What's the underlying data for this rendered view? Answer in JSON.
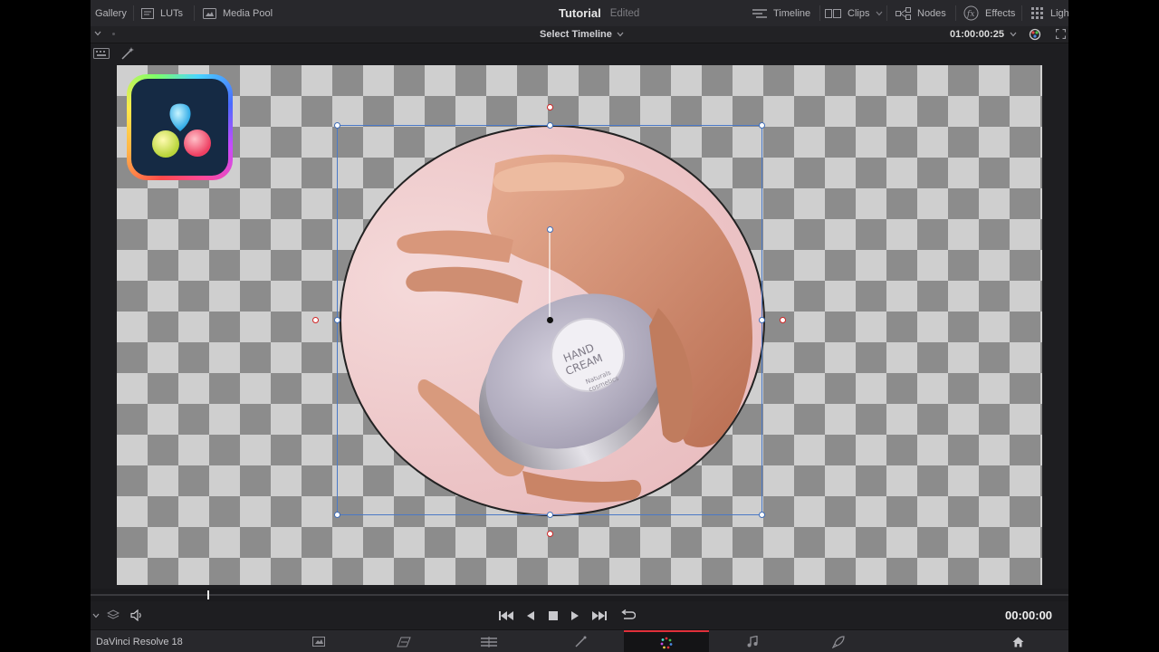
{
  "topbar": {
    "gallery": "Gallery",
    "luts": "LUTs",
    "media_pool": "Media Pool",
    "project_title": "Tutorial",
    "project_state": "Edited",
    "timeline": "Timeline",
    "clips": "Clips",
    "nodes": "Nodes",
    "effects": "Effects",
    "lightbox": "Ligh"
  },
  "viewer_bar": {
    "timeline_selector": "Select Timeline",
    "timecode": "01:00:00:25"
  },
  "viewer": {
    "label_line1": "HAND",
    "label_line2": "CREAM",
    "label_sub1": "Naturals",
    "label_sub2": "cosmetics"
  },
  "transport": {
    "timecode": "00:00:00"
  },
  "pagebar": {
    "app_name": "DaVinci Resolve 18",
    "active_page": "color"
  },
  "colors": {
    "accent_red": "#e0303a",
    "transform_box": "#4b79c6",
    "handle_red": "#d02626"
  }
}
